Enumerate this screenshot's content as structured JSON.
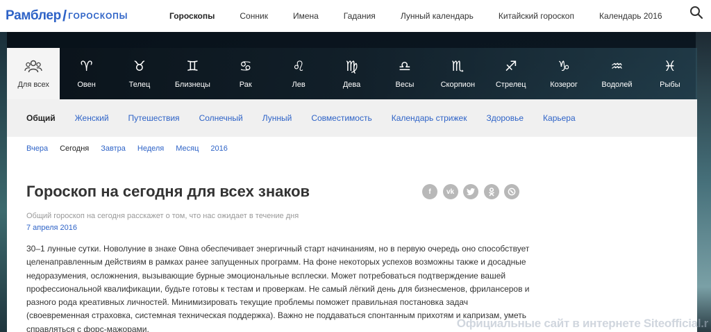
{
  "header": {
    "logo_main": "Рамблер",
    "logo_slash": "/",
    "logo_sub": "ГОРОСКОПЫ",
    "nav": [
      {
        "label": "Гороскопы",
        "active": true
      },
      {
        "label": "Сонник"
      },
      {
        "label": "Имена"
      },
      {
        "label": "Гадания"
      },
      {
        "label": "Лунный календарь"
      },
      {
        "label": "Китайский гороскоп"
      },
      {
        "label": "Календарь 2016"
      }
    ],
    "search_icon": "search-icon"
  },
  "zodiac": [
    {
      "label": "Для всех",
      "symbol": "",
      "icon": "people-icon",
      "active": true
    },
    {
      "label": "Овен",
      "symbol": "♈",
      "icon": "aries-icon"
    },
    {
      "label": "Телец",
      "symbol": "♉",
      "icon": "taurus-icon"
    },
    {
      "label": "Близнецы",
      "symbol": "♊",
      "icon": "gemini-icon"
    },
    {
      "label": "Рак",
      "symbol": "♋",
      "icon": "cancer-icon"
    },
    {
      "label": "Лев",
      "symbol": "♌",
      "icon": "leo-icon"
    },
    {
      "label": "Дева",
      "symbol": "♍",
      "icon": "virgo-icon"
    },
    {
      "label": "Весы",
      "symbol": "♎",
      "icon": "libra-icon"
    },
    {
      "label": "Скорпион",
      "symbol": "♏",
      "icon": "scorpio-icon"
    },
    {
      "label": "Стрелец",
      "symbol": "♐",
      "icon": "sagittarius-icon"
    },
    {
      "label": "Козерог",
      "symbol": "♑",
      "icon": "capricorn-icon"
    },
    {
      "label": "Водолей",
      "symbol": "♒",
      "icon": "aquarius-icon"
    },
    {
      "label": "Рыбы",
      "symbol": "♓",
      "icon": "pisces-icon"
    }
  ],
  "categories": [
    {
      "label": "Общий",
      "active": true
    },
    {
      "label": "Женский"
    },
    {
      "label": "Путешествия"
    },
    {
      "label": "Солнечный"
    },
    {
      "label": "Лунный"
    },
    {
      "label": "Совместимость"
    },
    {
      "label": "Календарь стрижек"
    },
    {
      "label": "Здоровье"
    },
    {
      "label": "Карьера"
    }
  ],
  "periods": [
    {
      "label": "Вчера"
    },
    {
      "label": "Сегодня",
      "active": true
    },
    {
      "label": "Завтра"
    },
    {
      "label": "Неделя"
    },
    {
      "label": "Месяц"
    },
    {
      "label": "2016"
    }
  ],
  "article": {
    "title": "Гороскоп на сегодня для всех знаков",
    "subtitle": "Общий гороскоп на сегодня расскажет о том, что нас ожидает в течение дня",
    "date": "7 апреля 2016",
    "body": "30–1 лунные сутки. Новолуние в знаке Овна обеспечивает энергичный старт начинаниям, но в первую очередь оно способствует целенаправленным действиям в рамках ранее запущенных программ. На фоне некоторых успехов возможны также и досадные недоразумения, осложнения, вызывающие бурные эмоциональные всплески. Может потребоваться подтверждение вашей профессиональной квалификации, будьте готовы к тестам и проверкам. Не самый лёгкий день для бизнесменов, фрилансеров и разного рода креативных личностей. Минимизировать текущие проблемы поможет правильная постановка задач (своевременная страховка, системная техническая поддержка). Важно не поддаваться спонтанным прихотям и капризам, уметь справляться с форс-мажорами."
  },
  "share": [
    {
      "label": "f",
      "icon": "facebook-icon"
    },
    {
      "label": "vk",
      "icon": "vk-icon"
    },
    {
      "label": "",
      "icon": "twitter-icon"
    },
    {
      "label": "",
      "icon": "odnoklassniki-icon"
    },
    {
      "label": "",
      "icon": "livejournal-icon"
    }
  ],
  "watermark": "Официальные сайт в интернете Siteofficial.r"
}
